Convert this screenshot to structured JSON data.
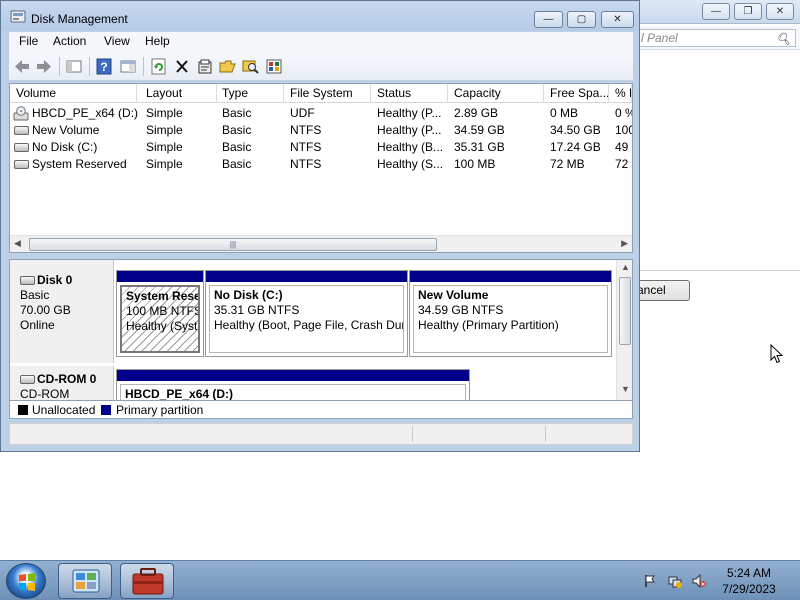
{
  "window": {
    "title": "Disk Management",
    "buttons": {
      "minimize": "—",
      "maximize": "▢",
      "close": "✕"
    }
  },
  "menu": [
    "File",
    "Action",
    "View",
    "Help"
  ],
  "toolbar": [
    "back-icon",
    "forward-icon",
    "show-hide-console-tree-icon",
    "help-icon",
    "properties-pane-icon",
    "refresh-icon",
    "delete-icon",
    "properties-icon",
    "open-icon",
    "explore-icon",
    "settings-icon"
  ],
  "volume_list": {
    "columns": [
      "Volume",
      "Layout",
      "Type",
      "File System",
      "Status",
      "Capacity",
      "Free Spa...",
      "% F"
    ],
    "rows": [
      {
        "volume": "HBCD_PE_x64 (D:)",
        "layout": "Simple",
        "type": "Basic",
        "fs": "UDF",
        "status": "Healthy (P...",
        "capacity": "2.89 GB",
        "free": "0 MB",
        "pct": "0 %"
      },
      {
        "volume": "New Volume",
        "layout": "Simple",
        "type": "Basic",
        "fs": "NTFS",
        "status": "Healthy (P...",
        "capacity": "34.59 GB",
        "free": "34.50 GB",
        "pct": "100"
      },
      {
        "volume": "No Disk (C:)",
        "layout": "Simple",
        "type": "Basic",
        "fs": "NTFS",
        "status": "Healthy (B...",
        "capacity": "35.31 GB",
        "free": "17.24 GB",
        "pct": "49"
      },
      {
        "volume": "System Reserved",
        "layout": "Simple",
        "type": "Basic",
        "fs": "NTFS",
        "status": "Healthy (S...",
        "capacity": "100 MB",
        "free": "72 MB",
        "pct": "72"
      }
    ]
  },
  "disks": [
    {
      "name": "Disk 0",
      "kind": "Basic",
      "size": "70.00 GB",
      "state": "Online",
      "partitions": [
        {
          "name": "System Reser",
          "size": "100 MB NTFS",
          "status": "Healthy (Syste"
        },
        {
          "name": "No Disk  (C:)",
          "size": "35.31 GB NTFS",
          "status": "Healthy (Boot, Page File, Crash Dum"
        },
        {
          "name": "New Volume",
          "size": "34.59 GB NTFS",
          "status": "Healthy (Primary Partition)"
        }
      ]
    },
    {
      "name": "CD-ROM 0",
      "kind": "CD-ROM",
      "partitions": [
        {
          "name": "HBCD_PE_x64  (D:)"
        }
      ]
    }
  ],
  "legend": {
    "unallocated": "Unallocated",
    "primary": "Primary partition",
    "colors": {
      "unallocated": "#000000",
      "primary": "#00008b"
    }
  },
  "background_window": {
    "search_text": "l Panel",
    "cancel_label": "ancel"
  },
  "taskbar": {
    "time": "5:24 AM",
    "date": "7/29/2023",
    "tray_icons": [
      "action-center-flag-icon",
      "network-icon",
      "volume-muted-icon"
    ],
    "pinned": [
      "control-panel-icon",
      "toolbox-icon"
    ]
  }
}
